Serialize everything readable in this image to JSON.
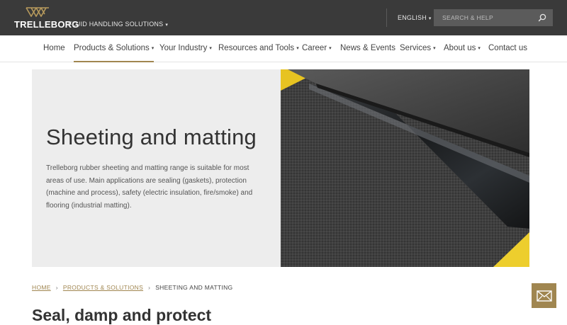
{
  "brand": {
    "logo_text": "TRELLEBORG",
    "division": "FLUID HANDLING SOLUTIONS"
  },
  "topbar": {
    "language": "ENGLISH",
    "search_placeholder": "SEARCH & HELP"
  },
  "nav": {
    "items": [
      {
        "label": "Home"
      },
      {
        "label": "Products & Solutions"
      },
      {
        "label": "Your Industry"
      },
      {
        "label": "Resources and Tools"
      },
      {
        "label": "Career"
      },
      {
        "label": "News & Events"
      },
      {
        "label": "Services"
      },
      {
        "label": "About us"
      },
      {
        "label": "Contact us"
      }
    ]
  },
  "hero": {
    "title": "Sheeting and matting",
    "description": "Trelleborg rubber sheeting and matting range is suitable for most areas of use. Main applications are sealing (gaskets), protection (machine and process), safety (electric insulation, fire/smoke) and flooring (industrial matting)."
  },
  "breadcrumb": {
    "home": "HOME",
    "products": "PRODUCTS & SOLUTIONS",
    "current": "SHEETING AND MATTING",
    "separator": "›"
  },
  "section": {
    "title": "Seal, damp and protect"
  },
  "colors": {
    "accent": "#a08650",
    "topbar": "#3a3a3a",
    "hero_bg": "#ededed"
  },
  "icons": {
    "search": "search-icon",
    "contact": "envelope-icon",
    "logo": "trelleborg-crown-icon"
  }
}
